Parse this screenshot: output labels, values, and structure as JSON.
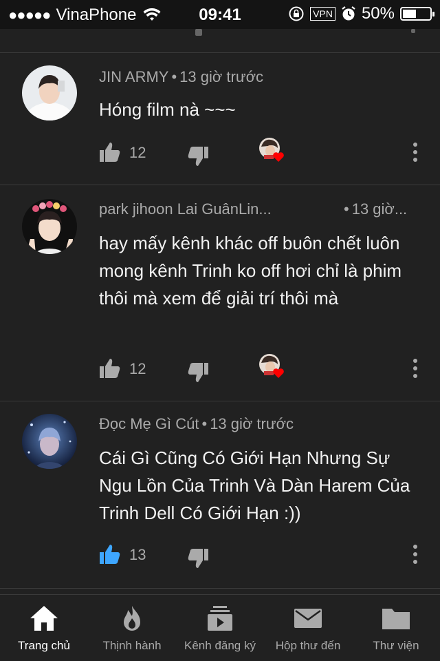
{
  "status_bar": {
    "signal": "●●●●●",
    "carrier": "VinaPhone",
    "time": "09:41",
    "vpn": "VPN",
    "battery": "50%",
    "battery_level": 0.5
  },
  "comments": [
    {
      "author": "JIN ARMY",
      "time": "13 giờ trước",
      "text": "Hóng film nà ~~~",
      "likes": "12",
      "liked": false,
      "creator_heart": true
    },
    {
      "author": "park jihoon Lai GuânLin...",
      "time": "13 giờ...",
      "text": "hay mấy kênh khác off buôn chết luôn mong kênh Trinh ko off hơi chỉ là phim thôi mà xem để giải trí thôi mà",
      "likes": "12",
      "liked": false,
      "creator_heart": true
    },
    {
      "author": "Đọc Mẹ Gì Cút",
      "time": "13 giờ trước",
      "text": "Cái Gì Cũng Có Giới Hạn Nhưng Sự Ngu Lồn Của Trinh Và Dàn Harem Của Trinh Dell Có Giới Hạn :))",
      "likes": "13",
      "liked": true,
      "creator_heart": false
    }
  ],
  "tabs": [
    {
      "label": "Trang chủ",
      "icon": "home-icon",
      "active": true
    },
    {
      "label": "Thịnh hành",
      "icon": "flame-icon",
      "active": false
    },
    {
      "label": "Kênh đăng ký",
      "icon": "subscriptions-icon",
      "active": false
    },
    {
      "label": "Hộp thư đến",
      "icon": "inbox-mail-icon",
      "active": false
    },
    {
      "label": "Thư viện",
      "icon": "library-folder-icon",
      "active": false
    }
  ],
  "colors": {
    "background": "#212121",
    "liked_blue": "#3ea6ff",
    "heart_red": "#ff0000",
    "secondary_text": "#aaaaaa"
  }
}
